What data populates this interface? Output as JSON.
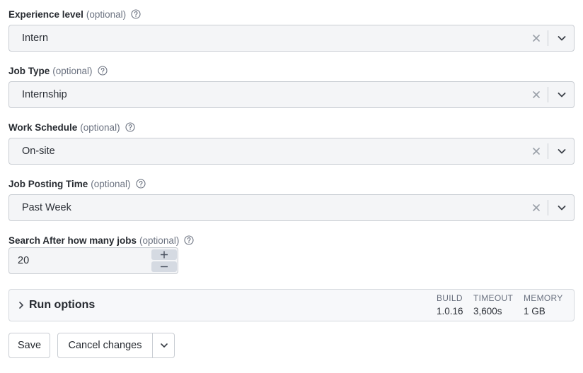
{
  "fields": [
    {
      "label": "Experience level",
      "optional": "(optional)",
      "value": "Intern"
    },
    {
      "label": "Job Type",
      "optional": "(optional)",
      "value": "Internship"
    },
    {
      "label": "Work Schedule",
      "optional": "(optional)",
      "value": "On-site"
    },
    {
      "label": "Job Posting Time",
      "optional": "(optional)",
      "value": "Past Week"
    }
  ],
  "jobs_field": {
    "label": "Search After how many jobs",
    "optional": "(optional)",
    "value": "20"
  },
  "run_options": {
    "title": "Run options",
    "build": {
      "label": "BUILD",
      "value": "1.0.16"
    },
    "timeout": {
      "label": "TIMEOUT",
      "value": "3,600s"
    },
    "memory": {
      "label": "MEMORY",
      "value": "1 GB"
    }
  },
  "actions": {
    "save": "Save",
    "cancel": "Cancel changes"
  },
  "icons": {
    "help": "help-circle-icon",
    "clear": "x-icon",
    "dropdown": "chevron-down-icon",
    "expand": "chevron-right-icon",
    "increment": "plus-icon",
    "decrement": "minus-icon"
  },
  "colors": {
    "field_bg": "#f4f5f7",
    "border": "#c9cdd3",
    "muted_text": "#6b7280",
    "stepper_btn": "#d5dae2"
  }
}
